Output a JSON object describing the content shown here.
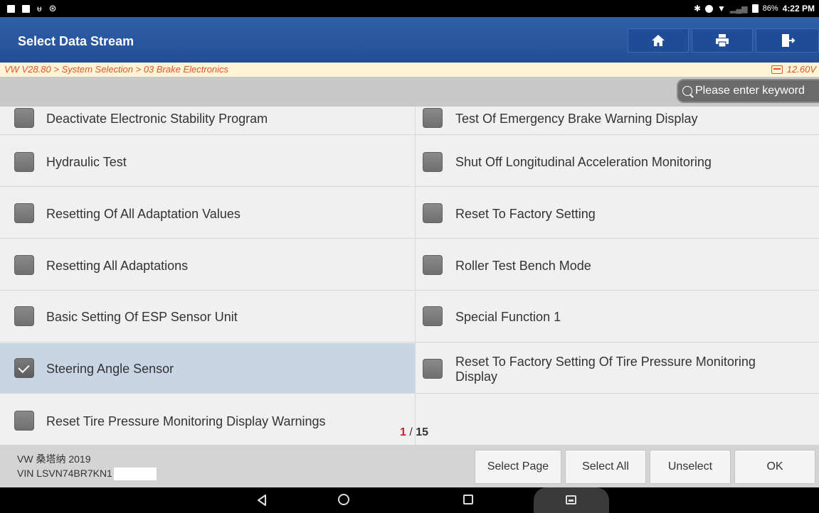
{
  "status_bar": {
    "battery": "86%",
    "time": "4:22 PM"
  },
  "titlebar": {
    "title": "Select Data Stream",
    "home_icon": "home-icon",
    "print_icon": "print-icon",
    "exit_icon": "exit-icon"
  },
  "breadcrumb": {
    "path": "VW V28.80 > System Selection > 03 Brake Electronics",
    "voltage": "12.60V"
  },
  "search": {
    "placeholder": "Please enter keyword"
  },
  "list": {
    "left": [
      {
        "label": "Deactivate Electronic Stability Program",
        "checked": false
      },
      {
        "label": "Hydraulic Test",
        "checked": false
      },
      {
        "label": "Resetting Of All Adaptation Values",
        "checked": false
      },
      {
        "label": "Resetting All Adaptations",
        "checked": false
      },
      {
        "label": "Basic Setting Of ESP Sensor Unit",
        "checked": false
      },
      {
        "label": "Steering Angle Sensor",
        "checked": true
      },
      {
        "label": "Reset Tire Pressure Monitoring Display Warnings",
        "checked": false
      }
    ],
    "right": [
      {
        "label": "Test Of Emergency Brake Warning Display",
        "checked": false
      },
      {
        "label": "Shut Off Longitudinal Acceleration Monitoring",
        "checked": false
      },
      {
        "label": "Reset To Factory Setting",
        "checked": false
      },
      {
        "label": "Roller Test Bench Mode",
        "checked": false
      },
      {
        "label": "Special Function 1",
        "checked": false
      },
      {
        "label": "Reset To Factory Setting Of Tire Pressure Monitoring Display",
        "checked": false
      }
    ]
  },
  "pager": {
    "current": "1",
    "separator": "/",
    "total": "15"
  },
  "footer": {
    "vehicle": "VW 桑塔纳 2019",
    "vin": "VIN LSVN74BR7KN1",
    "buttons": {
      "select_page": "Select Page",
      "select_all": "Select All",
      "unselect": "Unselect",
      "ok": "OK"
    }
  },
  "colors": {
    "title_bar": "#2f5fa8",
    "breadcrumb_text": "#e0552a",
    "selected_row": "#c8d5e4",
    "pager_current": "#d42020"
  }
}
